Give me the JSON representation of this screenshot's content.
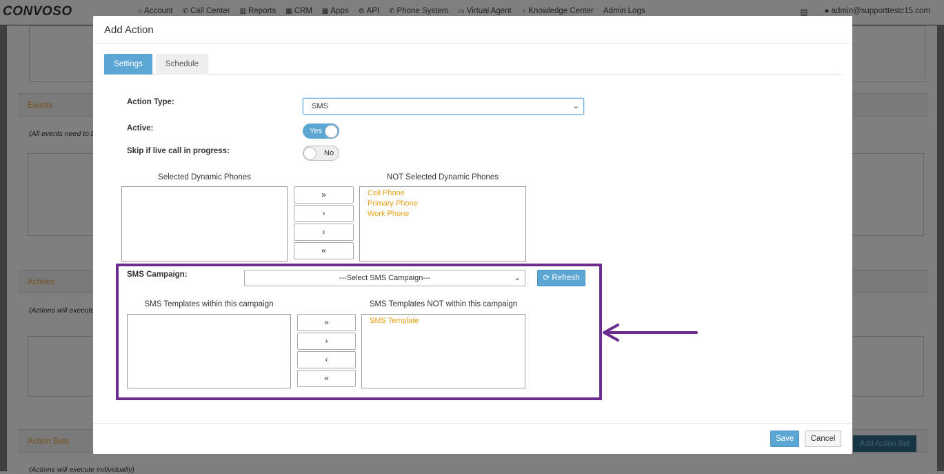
{
  "app": {
    "logo": "CONVOSO",
    "nav": [
      {
        "label": "Account",
        "icon": "home-icon",
        "glyph": "⌂"
      },
      {
        "label": "Call Center",
        "icon": "phone-icon",
        "glyph": "✆"
      },
      {
        "label": "Reports",
        "icon": "bar-chart-icon",
        "glyph": "▥"
      },
      {
        "label": "CRM",
        "icon": "table-icon",
        "glyph": "▦"
      },
      {
        "label": "Apps",
        "icon": "grid-icon",
        "glyph": "▦"
      },
      {
        "label": "API",
        "icon": "gear-icon",
        "glyph": "⚙"
      },
      {
        "label": "Phone System",
        "icon": "phone-icon",
        "glyph": "✆"
      },
      {
        "label": "Virtual Agent",
        "icon": "monitor-icon",
        "glyph": "▭"
      },
      {
        "label": "Knowledge Center",
        "icon": "lightbulb-icon",
        "glyph": "♀"
      },
      {
        "label": "Admin Logs",
        "icon": "",
        "glyph": ""
      }
    ],
    "user": "admin@supporttestc15.com",
    "background": {
      "events_heading": "Events",
      "events_note": "(All events need to be",
      "actions_heading": "Actions",
      "actions_note": "(Actions will execute",
      "action_sets_heading": "Action Sets",
      "action_sets_note": "(Actions will execute individually)",
      "add_action_set_label": "Add Action Set"
    }
  },
  "modal": {
    "title": "Add Action",
    "tabs": [
      "Settings",
      "Schedule"
    ],
    "active_tab": "Settings",
    "action_type": {
      "label": "Action Type:",
      "value": "SMS"
    },
    "active": {
      "label": "Active:",
      "value": "Yes",
      "on": true
    },
    "skip_live": {
      "label": "Skip if live call in progress:",
      "value": "No",
      "on": false
    },
    "dynamic_phones": {
      "selected_title": "Selected Dynamic Phones",
      "not_selected_title": "NOT Selected Dynamic Phones",
      "selected": [],
      "not_selected": [
        "Cell Phone",
        "Primary Phone",
        "Work Phone"
      ]
    },
    "move_buttons": [
      "»",
      "›",
      "‹",
      "«"
    ],
    "sms_campaign": {
      "label": "SMS Campaign:",
      "placeholder": "---Select SMS Campaign---",
      "refresh_label": "Refresh",
      "within_title": "SMS Templates within this campaign",
      "not_within_title": "SMS Templates NOT within this campaign",
      "within": [],
      "not_within": [
        "SMS Template"
      ]
    },
    "save_label": "Save",
    "cancel_label": "Cancel"
  },
  "colors": {
    "accent": "#5ba6d3",
    "highlight": "#6b2c8e",
    "list_item": "#e8a01c"
  }
}
